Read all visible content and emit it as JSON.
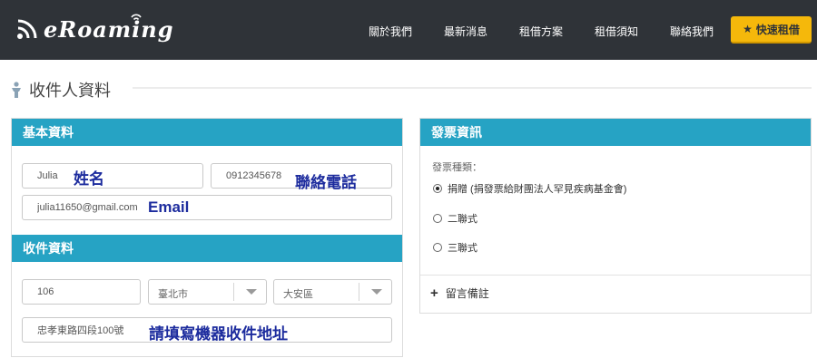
{
  "header": {
    "logo_text": "eRoaming",
    "nav": [
      "關於我們",
      "最新消息",
      "租借方案",
      "租借須知",
      "聯絡我們"
    ],
    "cta_label": "快速租借",
    "cta_icon": "star-icon",
    "bg_color": "#2f3338",
    "cta_color": "#f5b80b"
  },
  "page": {
    "title": "收件人資料",
    "title_icon": "person-icon"
  },
  "basic": {
    "heading": "基本資料",
    "name_value": "Julia",
    "name_note": "姓名",
    "phone_value": "0912345678",
    "phone_note": "聯絡電話",
    "email_value": "julia11650@gmail.com",
    "email_note": "Email"
  },
  "shipping": {
    "heading": "收件資料",
    "zip_value": "106",
    "city_value": "臺北市",
    "district_value": "大安區",
    "address_value": "忠孝東路四段100號",
    "address_note": "請填寫機器收件地址"
  },
  "invoice": {
    "heading": "發票資訊",
    "type_label": "發票種類：",
    "options": [
      {
        "label": "捐贈 (捐發票給財團法人罕見疾病基金會)",
        "selected": true
      },
      {
        "label": "二聯式",
        "selected": false
      },
      {
        "label": "三聯式",
        "selected": false
      }
    ],
    "notes_label": "留言備註",
    "notes_icon": "plus-icon"
  },
  "accent_color": "#26a3c4",
  "annotation_color": "#1d2c9e"
}
